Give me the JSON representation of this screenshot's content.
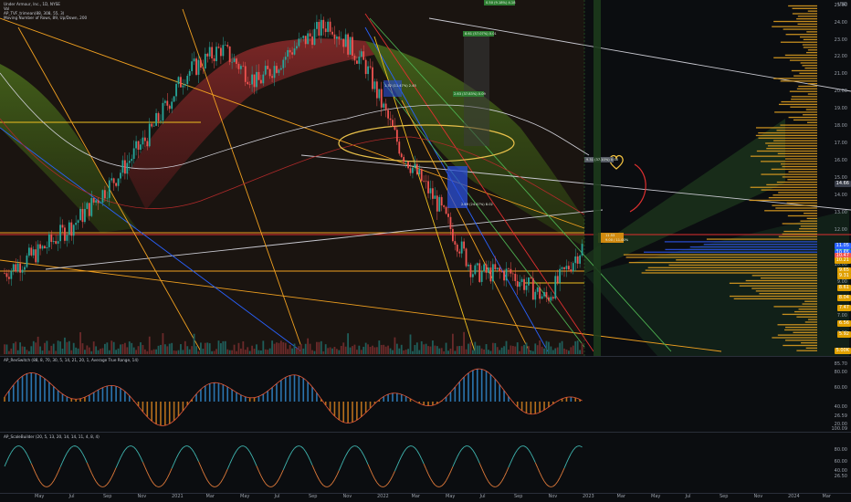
{
  "legend": {
    "line1": "Under Armour, Inc., 1D, NYSE",
    "line2": "Vol",
    "line3": "AP_TVF_trimean(88, 308, 55, 3)",
    "line4": "Moving Number of Rows, 89, Up/Down, 200"
  },
  "indicator1_title": "AP_RevSwitch (88, 8, 70, 30, 5, 14, 21, 20, 1, Average True Range, 14)",
  "indicator2_title": "AP_ScaleBuilder (20, 5, 13, 20, 14, 14, 11, 4, 8, 4)",
  "currency": "USD",
  "price_axis": [
    "25.00",
    "24.00",
    "23.00",
    "22.00",
    "21.00",
    "20.00",
    "19.00",
    "18.00",
    "17.00",
    "16.00",
    "15.00",
    "14.00",
    "13.00",
    "12.00",
    "11.00",
    "10.00",
    "9.00",
    "8.00",
    "7.00",
    "6.00",
    "5.00"
  ],
  "price_tags": [
    {
      "text": "14.66",
      "bg": "#3a3f4b"
    },
    {
      "text": "11.05",
      "bg": "#2962ff"
    },
    {
      "text": "10.70",
      "bg": "#26a69a"
    },
    {
      "text": "10.65",
      "bg": "#2962ff"
    },
    {
      "text": "10.47",
      "bg": "#ef5350"
    },
    {
      "text": "10.21",
      "bg": "#e0a000"
    },
    {
      "text": "9.65",
      "bg": "#e0a000"
    },
    {
      "text": "9.31",
      "bg": "#e0a000"
    },
    {
      "text": "8.61",
      "bg": "#e0a000"
    },
    {
      "text": "8.04",
      "bg": "#e0a000"
    },
    {
      "text": "7.47",
      "bg": "#e0a000"
    },
    {
      "text": "6.56",
      "bg": "#e0a000"
    },
    {
      "text": "5.92",
      "bg": "#e0a000"
    },
    {
      "text": "5.00K",
      "bg": "#e0a000"
    }
  ],
  "ind1_axis": [
    "85.70",
    "80.00",
    "60.00",
    "40.00",
    "26.59",
    "20.00",
    "100.09"
  ],
  "ind2_axis": [
    "80.00",
    "60.00",
    "40.00",
    "26.50"
  ],
  "time_axis": [
    "May",
    "Jul",
    "Sep",
    "Nov",
    "2021",
    "Mar",
    "May",
    "Jul",
    "Sep",
    "Nov",
    "2022",
    "Mar",
    "May",
    "Jul",
    "Sep",
    "Nov",
    "2023",
    "Mar",
    "May",
    "Jul",
    "Sep",
    "Nov",
    "2024",
    "Mar"
  ],
  "box_labels": [
    "0.50 (9.18%) 4.18",
    "8.61 (57.07%) 0.01",
    "2.63 (37.83%) 0.09",
    "1.32 (11.47%) 2.45",
    "2.69 (24.47%) 8.02",
    "9.31 (37.10%) 0.08",
    "11.53",
    "9.00 / 11.00%"
  ],
  "colors": {
    "background": "#0b0d10",
    "candle_up": "#26a69a",
    "candle_down": "#ef5350",
    "trend_line_orange": "#f0a020",
    "trend_line_green": "#4caf50",
    "trend_line_blue": "#2962ff",
    "ellipse": "#e8c04a",
    "heart": "#f0c040",
    "arrow": "#e03030",
    "volume_profile": "#d89a20",
    "volume_profile_blue": "#2a4fd8"
  },
  "chart_data": {
    "type": "candlestick",
    "title": "Under Armour, Inc., 1D, NYSE",
    "ylabel": "USD",
    "ylim": [
      4.7,
      25.3
    ],
    "x": [
      "May 2020",
      "Jul 2020",
      "Sep 2020",
      "Nov 2020",
      "Jan 2021",
      "Mar 2021",
      "May 2021",
      "Jul 2021",
      "Sep 2021",
      "Nov 2021",
      "Jan 2022",
      "Mar 2022",
      "May 2022",
      "Jul 2022",
      "Sep 2022",
      "Nov 2022",
      "Jan 2023"
    ],
    "close": [
      9.5,
      10.8,
      12.5,
      14.8,
      17.5,
      21.0,
      22.5,
      20.5,
      22.5,
      24.0,
      21.5,
      16.5,
      13.5,
      9.5,
      9.5,
      8.0,
      11.0
    ],
    "current_price": 11.05
  }
}
